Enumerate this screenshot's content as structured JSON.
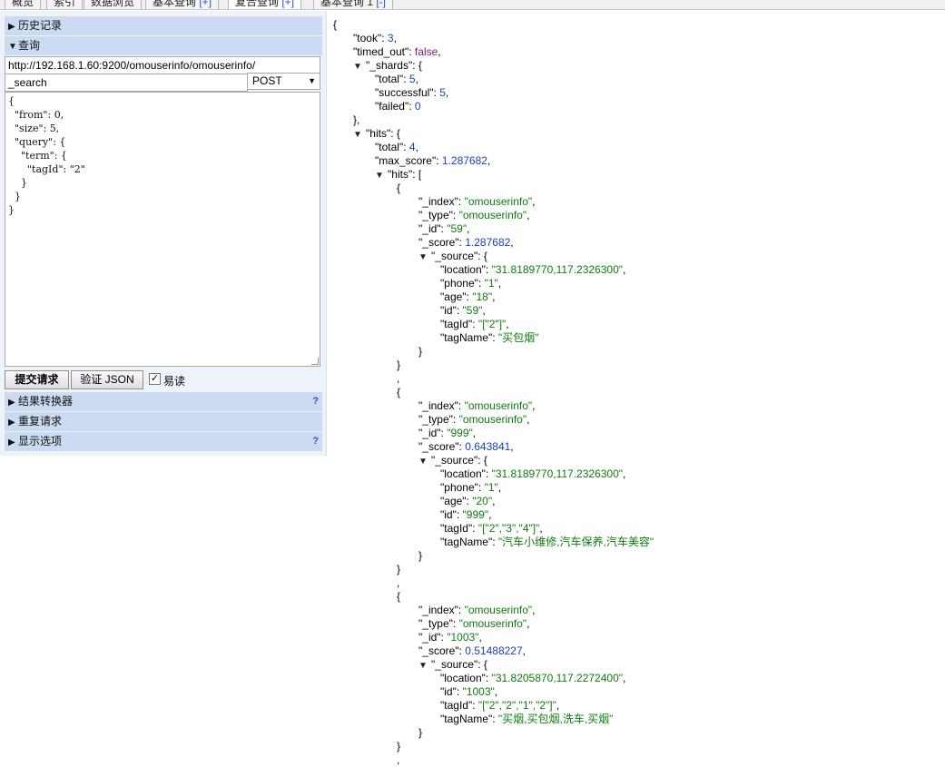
{
  "tabs": [
    {
      "label": "概览",
      "mod": ""
    },
    {
      "label": "索引",
      "mod": ""
    },
    {
      "label": "数据浏览",
      "mod": ""
    },
    {
      "label": "基本查询",
      "mod": "[+]"
    },
    {
      "label": "复合查询",
      "mod": "[+]"
    },
    {
      "label": "基本查询 1",
      "mod": "[-]"
    }
  ],
  "panel": {
    "history_label": "历史记录",
    "query_label": "查询",
    "url_value": "http://192.168.1.60:9200/omouserinfo/omouserinfo/",
    "path_value": "_search",
    "method_value": "POST",
    "body_lines": [
      "{",
      "  \"from\": 0,",
      "  \"size\": 5,",
      "  \"query\": {",
      "    \"term\": {",
      "      \"tagId\": \"2\"",
      "    }",
      "  }",
      "}"
    ],
    "submit_label": "提交请求",
    "validate_label": "验证 JSON",
    "pretty_label": "易读",
    "pretty_checked": "✓",
    "transformer_label": "结果转换器",
    "repeat_label": "重复请求",
    "display_label": "显示选项",
    "help_mark": "?"
  },
  "icons": {
    "collapsed": "▶",
    "expanded": "▼",
    "dropdown": "▼"
  },
  "response": {
    "took": "3",
    "timed_out": "false",
    "shards": {
      "total": "5",
      "successful": "5",
      "failed": "0"
    },
    "hits_total": "4",
    "max_score": "1.287682",
    "hits": [
      {
        "_index": "\"omouserinfo\"",
        "_type": "\"omouserinfo\"",
        "_id": "\"59\"",
        "_score": "1.287682",
        "source": [
          [
            "location",
            "\"31.8189770,117.2326300\""
          ],
          [
            "phone",
            "\"1\""
          ],
          [
            "age",
            "\"18\""
          ],
          [
            "id",
            "\"59\""
          ],
          [
            "tagId",
            "\"[\"2\"]\""
          ],
          [
            "tagName",
            "\"买包烟\""
          ]
        ]
      },
      {
        "_index": "\"omouserinfo\"",
        "_type": "\"omouserinfo\"",
        "_id": "\"999\"",
        "_score": "0.643841",
        "source": [
          [
            "location",
            "\"31.8189770,117.2326300\""
          ],
          [
            "phone",
            "\"1\""
          ],
          [
            "age",
            "\"20\""
          ],
          [
            "id",
            "\"999\""
          ],
          [
            "tagId",
            "\"[\"2\",\"3\",\"4\"]\""
          ],
          [
            "tagName",
            "\"汽车小维修,汽车保养,汽车美容\""
          ]
        ]
      },
      {
        "_index": "\"omouserinfo\"",
        "_type": "\"omouserinfo\"",
        "_id": "\"1003\"",
        "_score": "0.51488227",
        "source": [
          [
            "location",
            "\"31.8205870,117.2272400\""
          ],
          [
            "id",
            "\"1003\""
          ],
          [
            "tagId",
            "\"[\"2\",\"2\",\"1\",\"2\"]\""
          ],
          [
            "tagName",
            "\"买烟,买包烟,洗车,买烟\""
          ]
        ]
      }
    ]
  }
}
